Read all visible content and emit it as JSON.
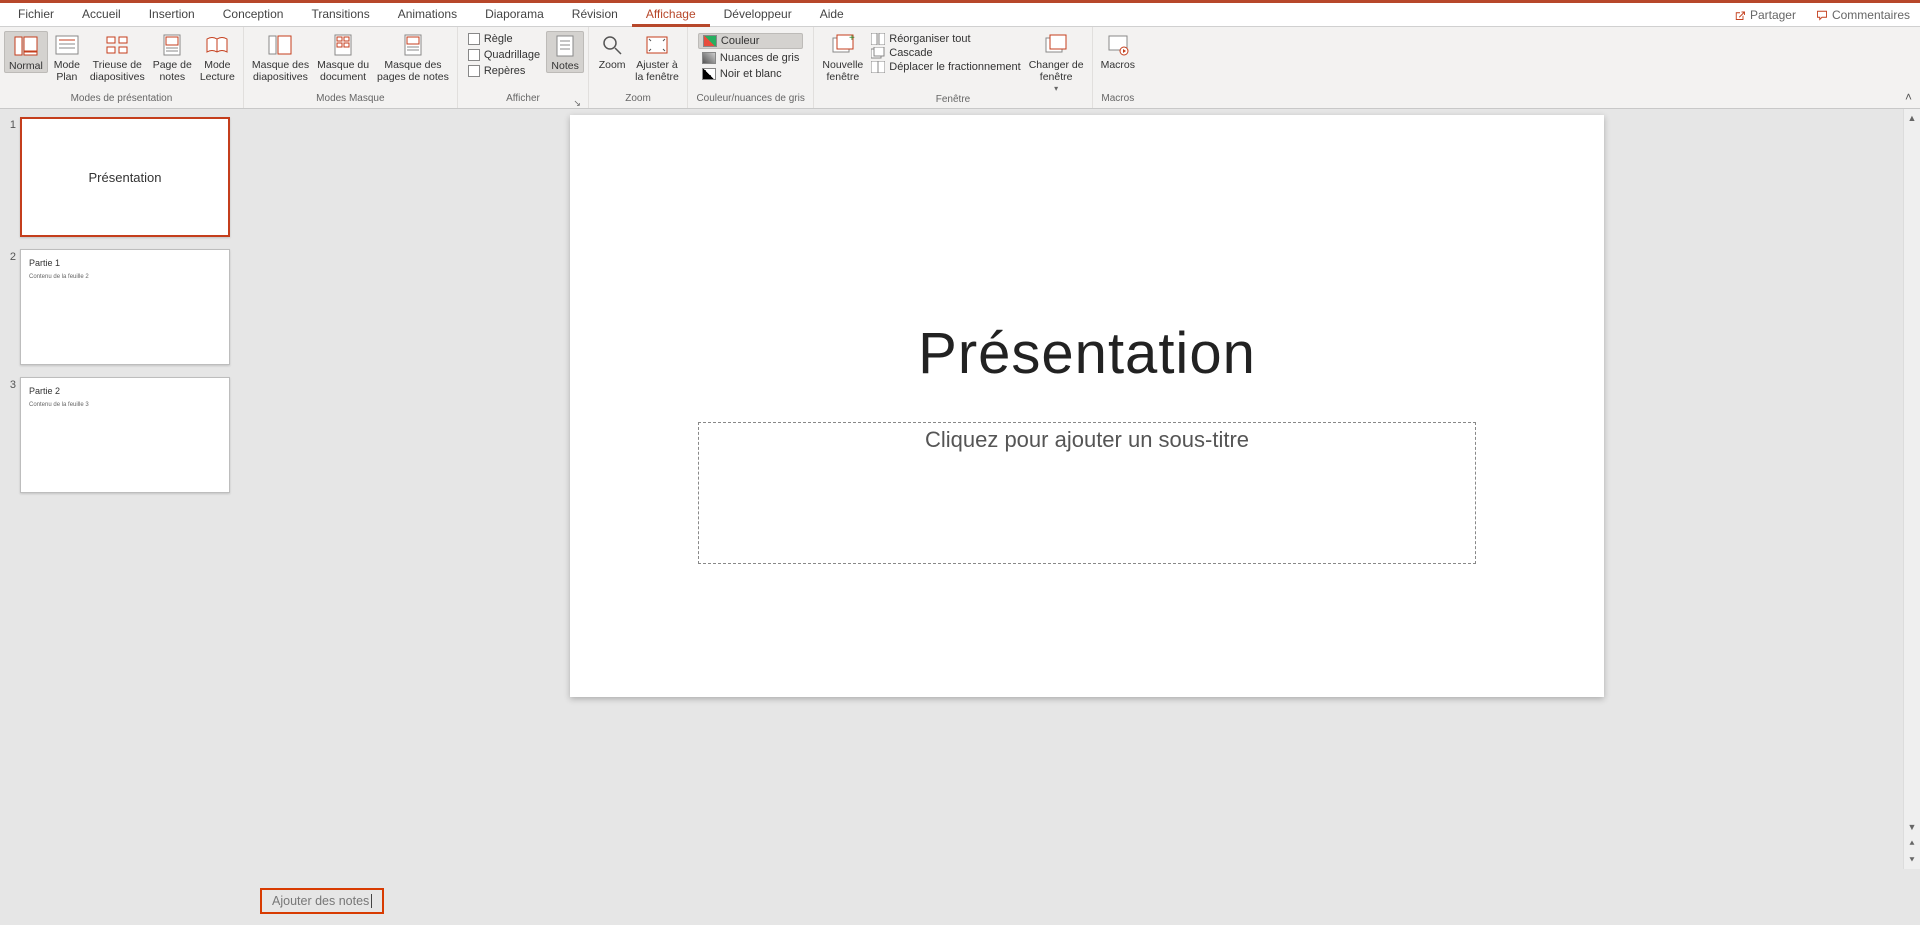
{
  "accent_color": "#b7472a",
  "tabs": {
    "items": [
      "Fichier",
      "Accueil",
      "Insertion",
      "Conception",
      "Transitions",
      "Animations",
      "Diaporama",
      "Révision",
      "Affichage",
      "Développeur",
      "Aide"
    ],
    "active_index": 8
  },
  "header_buttons": {
    "share": "Partager",
    "comments": "Commentaires"
  },
  "ribbon": {
    "groups": {
      "presentation_views": {
        "label": "Modes de présentation",
        "normal": "Normal",
        "outline": "Mode\nPlan",
        "sorter": "Trieuse de\ndiapositives",
        "notes_page": "Page de\nnotes",
        "reading": "Mode\nLecture"
      },
      "master_views": {
        "label": "Modes Masque",
        "slide_master": "Masque des\ndiapositives",
        "handout_master": "Masque du\ndocument",
        "notes_master": "Masque des\npages de notes"
      },
      "show": {
        "label": "Afficher",
        "ruler": "Règle",
        "gridlines": "Quadrillage",
        "guides": "Repères",
        "notes": "Notes"
      },
      "zoom": {
        "label": "Zoom",
        "zoom": "Zoom",
        "fit": "Ajuster à\nla fenêtre"
      },
      "color": {
        "label": "Couleur/nuances de gris",
        "color": "Couleur",
        "grayscale": "Nuances de gris",
        "bw": "Noir et blanc"
      },
      "window": {
        "label": "Fenêtre",
        "new_window": "Nouvelle\nfenêtre",
        "arrange_all": "Réorganiser tout",
        "cascade": "Cascade",
        "move_split": "Déplacer le fractionnement",
        "switch": "Changer de\nfenêtre"
      },
      "macros": {
        "label": "Macros",
        "macros": "Macros"
      }
    }
  },
  "thumbnails": [
    {
      "num": "1",
      "kind": "title",
      "title": "Présentation",
      "selected": true
    },
    {
      "num": "2",
      "kind": "content",
      "title": "Partie 1",
      "body": "Contenu de la feuille 2",
      "selected": false
    },
    {
      "num": "3",
      "kind": "content",
      "title": "Partie 2",
      "body": "Contenu de la feuille 3",
      "selected": false
    }
  ],
  "slide": {
    "title": "Présentation",
    "subtitle_placeholder": "Cliquez pour ajouter un sous-titre"
  },
  "notes": {
    "placeholder": "Ajouter des notes"
  }
}
